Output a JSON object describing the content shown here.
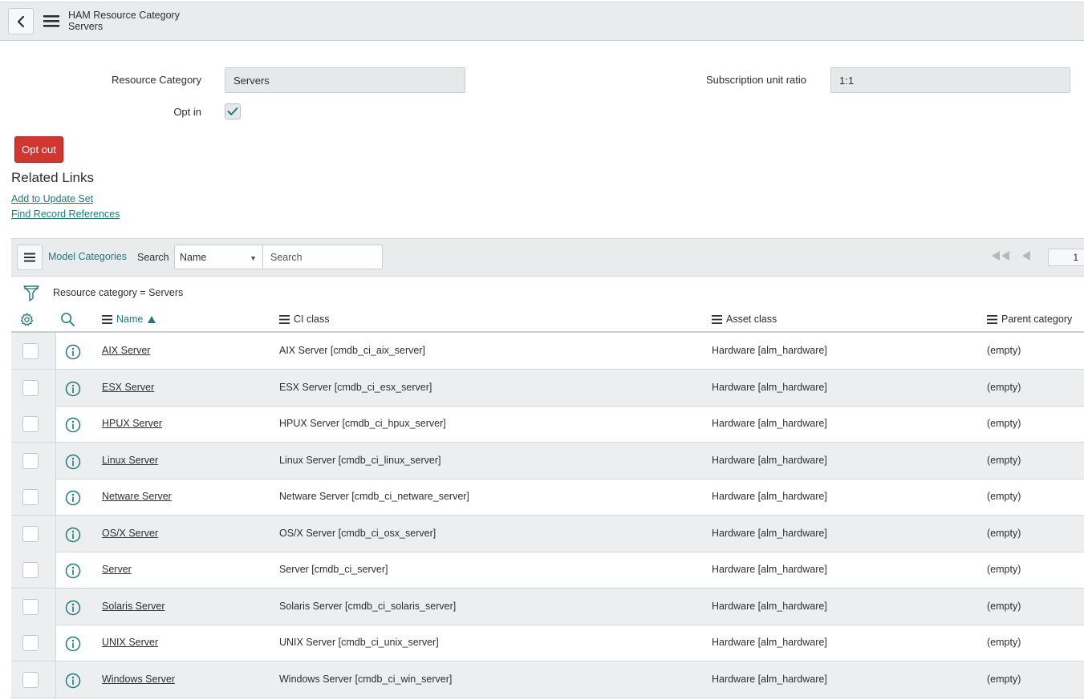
{
  "header": {
    "title": "HAM Resource Category",
    "subtitle": "Servers",
    "icons": {
      "back": "chevron-left-icon",
      "menu": "hamburger-menu-icon"
    }
  },
  "form": {
    "resource_category_label": "Resource Category",
    "resource_category_value": "Servers",
    "subscription_ratio_label": "Subscription unit ratio",
    "subscription_ratio_value": "1:1",
    "opt_in_label": "Opt in",
    "opt_in_checked": true,
    "opt_out_button": "Opt out"
  },
  "related_links": {
    "title": "Related Links",
    "links": [
      "Add to Update Set",
      "Find Record References"
    ]
  },
  "list": {
    "title": "Model Categories",
    "search_label": "Search",
    "search_field_selected": "Name",
    "search_placeholder": "Search",
    "page_number": "1",
    "filter_text": "Resource category = Servers",
    "columns": [
      "Name",
      "CI class",
      "Asset class",
      "Parent category"
    ],
    "sort_column": "Name",
    "sort_direction": "ascending",
    "rows": [
      {
        "name": "AIX Server",
        "ci_class": "AIX Server [cmdb_ci_aix_server]",
        "asset_class": "Hardware [alm_hardware]",
        "parent": "(empty)"
      },
      {
        "name": "ESX Server",
        "ci_class": "ESX Server [cmdb_ci_esx_server]",
        "asset_class": "Hardware [alm_hardware]",
        "parent": "(empty)"
      },
      {
        "name": "HPUX Server",
        "ci_class": "HPUX Server [cmdb_ci_hpux_server]",
        "asset_class": "Hardware [alm_hardware]",
        "parent": "(empty)"
      },
      {
        "name": "Linux Server",
        "ci_class": "Linux Server [cmdb_ci_linux_server]",
        "asset_class": "Hardware [alm_hardware]",
        "parent": "(empty)"
      },
      {
        "name": "Netware Server",
        "ci_class": "Netware Server [cmdb_ci_netware_server]",
        "asset_class": "Hardware [alm_hardware]",
        "parent": "(empty)"
      },
      {
        "name": "OS/X Server",
        "ci_class": "OS/X Server [cmdb_ci_osx_server]",
        "asset_class": "Hardware [alm_hardware]",
        "parent": "(empty)"
      },
      {
        "name": "Server",
        "ci_class": "Server [cmdb_ci_server]",
        "asset_class": "Hardware [alm_hardware]",
        "parent": "(empty)"
      },
      {
        "name": "Solaris Server",
        "ci_class": "Solaris Server [cmdb_ci_solaris_server]",
        "asset_class": "Hardware [alm_hardware]",
        "parent": "(empty)"
      },
      {
        "name": "UNIX Server",
        "ci_class": "UNIX Server [cmdb_ci_unix_server]",
        "asset_class": "Hardware [alm_hardware]",
        "parent": "(empty)"
      },
      {
        "name": "Windows Server",
        "ci_class": "Windows Server [cmdb_ci_win_server]",
        "asset_class": "Hardware [alm_hardware]",
        "parent": "(empty)"
      }
    ]
  },
  "colors": {
    "accent": "#1f7a7a",
    "danger": "#d1362f",
    "header_bg": "#e9ebed",
    "field_bg": "#e6e8ea"
  }
}
